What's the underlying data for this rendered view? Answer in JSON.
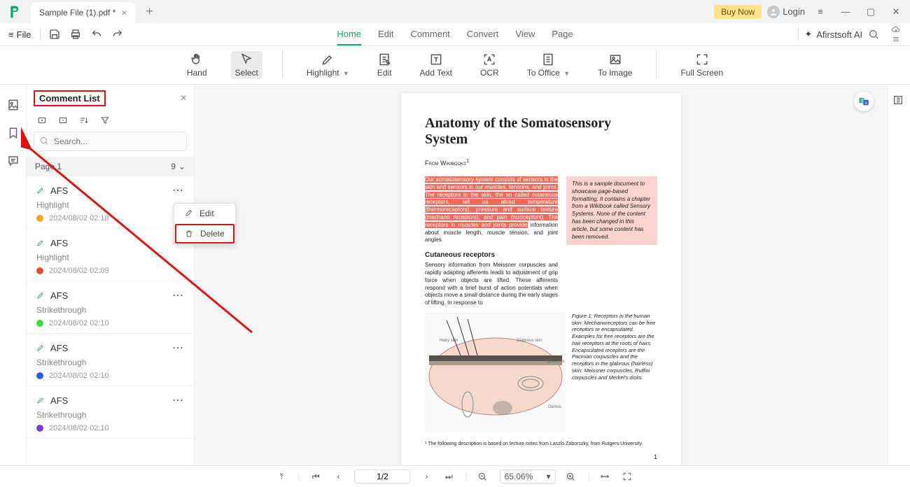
{
  "titlebar": {
    "tab_name": "Sample File (1).pdf *",
    "buy_now": "Buy Now",
    "login": "Login"
  },
  "menubar": {
    "file": "File",
    "tabs": [
      "Home",
      "Edit",
      "Comment",
      "Convert",
      "View",
      "Page"
    ],
    "active_tab": 0,
    "ai_label": "Afirstsoft AI"
  },
  "ribbon": {
    "tools": [
      {
        "label": "Hand"
      },
      {
        "label": "Select",
        "selected": true
      },
      {
        "label": "Highlight",
        "dropdown": true
      },
      {
        "label": "Edit"
      },
      {
        "label": "Add Text"
      },
      {
        "label": "OCR"
      },
      {
        "label": "To Office",
        "dropdown": true
      },
      {
        "label": "To Image"
      },
      {
        "label": "Full Screen"
      }
    ]
  },
  "sidebar": {
    "title": "Comment List",
    "search_placeholder": "Search...",
    "page_label": "Page 1",
    "page_count": "9",
    "comments": [
      {
        "author": "AFS",
        "type": "Highlight",
        "date": "2024/08/02 02:18",
        "color": "#f5a623"
      },
      {
        "author": "AFS",
        "type": "Highlight",
        "date": "2024/08/02 02:09",
        "color": "#e94b35"
      },
      {
        "author": "AFS",
        "type": "Strikethrough",
        "date": "2024/08/02 02:10",
        "color": "#3ddc3d"
      },
      {
        "author": "AFS",
        "type": "Strikethrough",
        "date": "2024/08/02 02:10",
        "color": "#2b5fd9"
      },
      {
        "author": "AFS",
        "type": "Strikethrough",
        "date": "2024/08/02 02:10",
        "color": "#7a3ed9"
      }
    ]
  },
  "context_menu": {
    "edit": "Edit",
    "delete": "Delete"
  },
  "document": {
    "title": "Anatomy of the Somatosensory System",
    "from": "From Wikibooks",
    "para1_hl": "Our somatosensory system consists of sensors in the skin and sensors in our muscles, tendons, and joints. The receptors in the skin, the so called cutaneous receptors, tell us about temperature (thermoreceptors), pressure and surface texture (mechano receptors), and pain (nociceptors). The receptors in muscles and joints provide",
    "para1_tail": " information about muscle length, muscle tension, and joint angles.",
    "note": "This is a sample document to showcase page-based formatting. It contains a chapter from a Wikibook called Sensory Systems. None of the content has been changed in this article, but some content has been removed.",
    "h2": "Cutaneous receptors",
    "para2": "Sensory information from Meissner corpuscles and rapidly adapting afferents leads to adjustment of grip force when objects are lifted. These afferents respond with a brief burst of action potentials when objects move a small distance during the early stages of lifting. In response to",
    "figcap": "Figure 1: Receptors in the human skin: Mechanoreceptors can be free receptors or encapsulated. Examples for free receptors are the hair receptors at the roots of hairs. Encapsulated receptors are the Pacinian corpuscles and the receptors in the glabrous (hairless) skin: Meissner corpuscles, Ruffini corpuscles and Merkel's disks.",
    "footnote": "¹ The following description is based on lecture notes from Laszlo Zaborszky, from Rutgers University.",
    "pagenum": "1"
  },
  "statusbar": {
    "page": "1/2",
    "zoom": "65.06%"
  }
}
